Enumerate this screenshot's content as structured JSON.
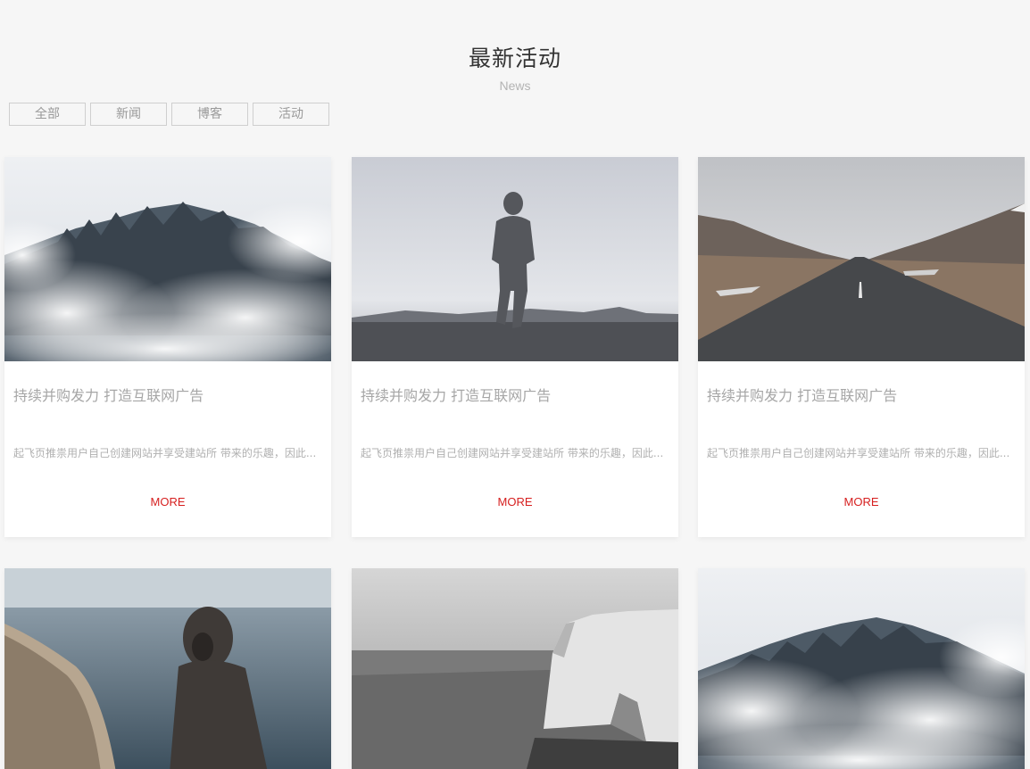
{
  "header": {
    "title": "最新活动",
    "subtitle": "News"
  },
  "filters": [
    "全部",
    "新闻",
    "博客",
    "活动"
  ],
  "cards": [
    {
      "image": "foggy-forest-photo",
      "title": "持续并购发力 打造互联网广告",
      "description": "起飞页推祟用户自己创建网站并享受建站所 带来的乐趣，因此...",
      "more_label": "MORE"
    },
    {
      "image": "person-walking-fog-photo",
      "title": "持续并购发力 打造互联网广告",
      "description": "起飞页推祟用户自己创建网站并享受建站所 带来的乐趣，因此...",
      "more_label": "MORE"
    },
    {
      "image": "mountain-road-photo",
      "title": "持续并购发力 打造互联网广告",
      "description": "起飞页推祟用户自己创建网站并享受建站所 带来的乐趣，因此...",
      "more_label": "MORE"
    },
    {
      "image": "hooded-person-beach-photo"
    },
    {
      "image": "sea-cliff-bw-photo"
    },
    {
      "image": "foggy-forest-photo"
    }
  ],
  "colors": {
    "background": "#f6f6f6",
    "more_link": "#d61f1f",
    "title_text": "#333333"
  }
}
